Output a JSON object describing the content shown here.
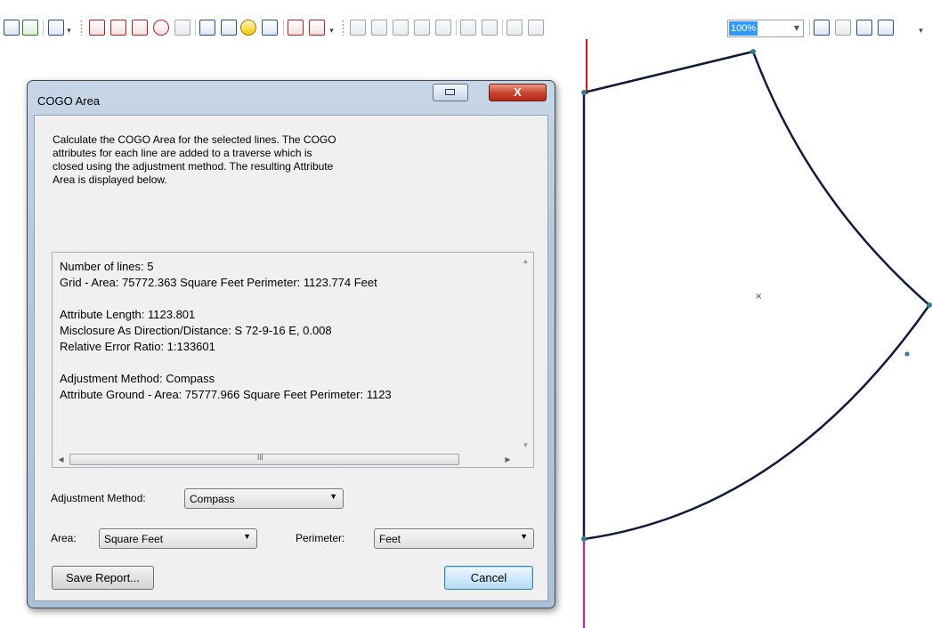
{
  "toolbar": {
    "zoom_value": "100%",
    "icons": [
      "table-icon",
      "chart-icon",
      "edit-icon",
      "more-icon",
      "cogo-line-icon",
      "cogo-curve-icon",
      "split-icon",
      "proportion-icon",
      "extend-icon",
      "direction-icon",
      "add-point-icon",
      "traverse-icon",
      "report-icon",
      "vertex-icon",
      "turn-icon",
      "more-icon-2",
      "zoom-in-icon",
      "zoom-out-icon",
      "pan-icon",
      "full-extent-icon",
      "fixed-zoom-icon",
      "zoom-in-fixed-icon",
      "zoom-out-fixed-icon",
      "back-icon",
      "forward-icon",
      "layout-icon",
      "focus-icon",
      "toggle-icon",
      "change-layout-icon",
      "more-icon-3"
    ]
  },
  "dialog": {
    "title": "COGO Area",
    "close_label": "X",
    "description": "Calculate the COGO Area for the selected lines.  The COGO attributes for each line are added to a traverse which is closed using the adjustment method. The resulting Attribute Area is displayed below.",
    "report": {
      "lines": [
        "Number of lines: 5",
        "Grid -      Area:  75772.363 Square Feet      Perimeter:  1123.774 Feet",
        "Attribute Length:  1123.801",
        "Misclosure As Direction/Distance:   S 72-9-16 E,  0.008",
        "Relative Error Ratio:  1:133601",
        "Adjustment Method:  Compass",
        "Attribute Ground - Area:   75777.966 Square Feet        Perimeter:  1123"
      ]
    },
    "adjustment_method_label": "Adjustment Method:",
    "adjustment_method_value": "Compass",
    "area_label": "Area:",
    "area_value": "Square Feet",
    "perimeter_label": "Perimeter:",
    "perimeter_value": "Feet",
    "save_report_label": "Save Report...",
    "cancel_label": "Cancel"
  },
  "map": {
    "line_color": "#0f1a3c",
    "axis_red": "#e81010",
    "axis_magenta": "#e010d0"
  }
}
